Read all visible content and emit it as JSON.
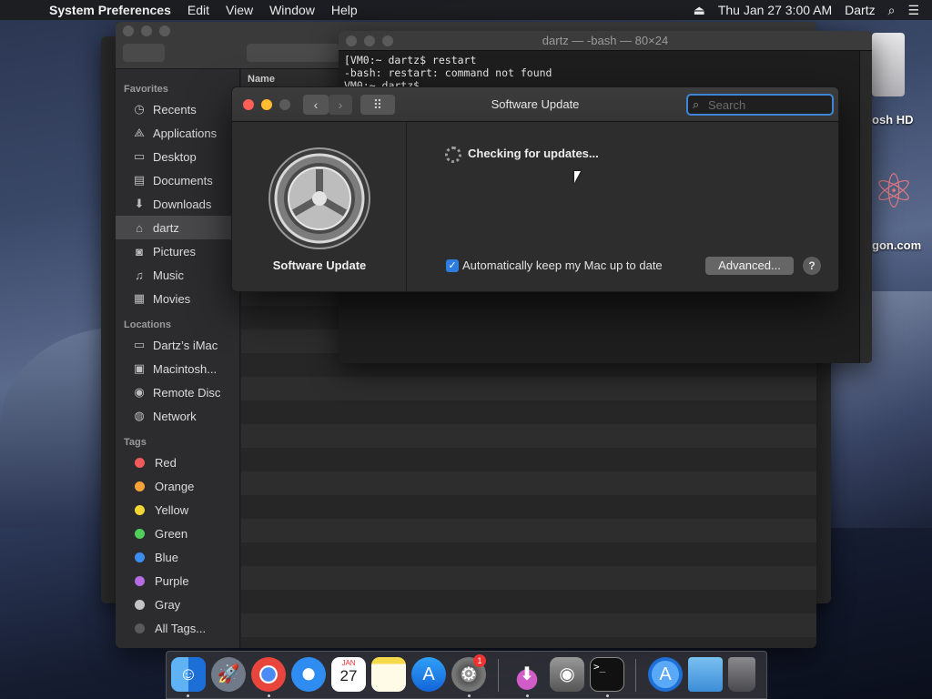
{
  "menubar": {
    "app_name": "System Preferences",
    "menus": [
      "Edit",
      "View",
      "Window",
      "Help"
    ],
    "datetime": "Thu Jan 27  3:00 AM",
    "user": "Dartz"
  },
  "finder": {
    "column_header": "Name",
    "sections": {
      "favorites": "Favorites",
      "locations": "Locations",
      "tags": "Tags"
    },
    "favorites": [
      {
        "label": "Recents",
        "icon": "clock-icon"
      },
      {
        "label": "Applications",
        "icon": "applications-icon"
      },
      {
        "label": "Desktop",
        "icon": "desktop-icon"
      },
      {
        "label": "Documents",
        "icon": "document-icon"
      },
      {
        "label": "Downloads",
        "icon": "download-icon"
      },
      {
        "label": "dartz",
        "icon": "home-icon",
        "selected": true
      },
      {
        "label": "Pictures",
        "icon": "camera-icon"
      },
      {
        "label": "Music",
        "icon": "music-icon"
      },
      {
        "label": "Movies",
        "icon": "film-icon"
      }
    ],
    "locations": [
      {
        "label": "Dartz’s iMac",
        "icon": "computer-icon"
      },
      {
        "label": "Macintosh...",
        "icon": "disk-icon"
      },
      {
        "label": "Remote Disc",
        "icon": "disc-icon"
      },
      {
        "label": "Network",
        "icon": "network-icon"
      }
    ],
    "tags": [
      {
        "label": "Red",
        "color": "#f05a5a"
      },
      {
        "label": "Orange",
        "color": "#f5a33a"
      },
      {
        "label": "Yellow",
        "color": "#f3d633"
      },
      {
        "label": "Green",
        "color": "#4fcf5a"
      },
      {
        "label": "Blue",
        "color": "#3b8ef0"
      },
      {
        "label": "Purple",
        "color": "#b66be3"
      },
      {
        "label": "Gray",
        "color": "#c4c4c4"
      },
      {
        "label": "All Tags...",
        "color": "#5a5a5a"
      }
    ]
  },
  "terminal": {
    "title": "dartz — -bash — 80×24",
    "line1": "[VM0:~ dartz$ restart",
    "line2": "-bash: restart: command not found",
    "line3": "VM0:~ dartz$ "
  },
  "software_update": {
    "title": "Software Update",
    "search_placeholder": "Search",
    "app_label": "Software Update",
    "status": "Checking for updates...",
    "auto_update_label": "Automatically keep my Mac up to date",
    "auto_update_checked": true,
    "advanced_label": "Advanced...",
    "help_label": "?"
  },
  "desktop": {
    "hd_label": "osh HD",
    "web_label": "gon.com"
  },
  "dock": {
    "calendar_month": "JAN",
    "calendar_day": "27",
    "syspref_badge": "1",
    "terminal_prompt": ">_"
  }
}
